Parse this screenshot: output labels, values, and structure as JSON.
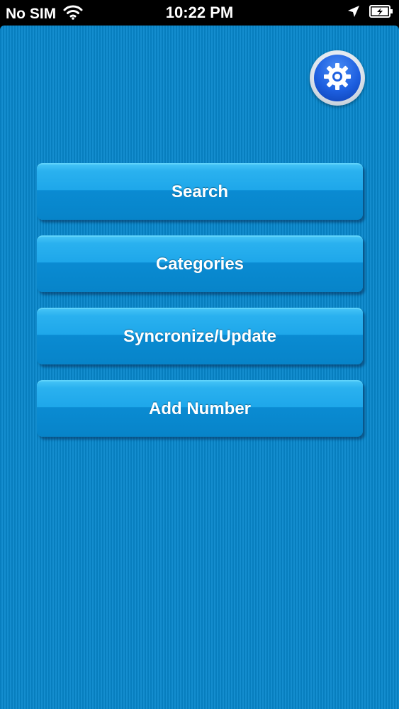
{
  "status_bar": {
    "carrier": "No SIM",
    "time": "10:22 PM"
  },
  "menu": {
    "buttons": [
      {
        "label": "Search"
      },
      {
        "label": "Categories"
      },
      {
        "label": "Syncronize/Update"
      },
      {
        "label": "Add Number"
      }
    ]
  },
  "icons": {
    "wifi": "wifi-icon",
    "location": "location-arrow-icon",
    "battery": "battery-charging-icon",
    "settings": "gear-icon"
  },
  "colors": {
    "background": "#0787cc",
    "button_top": "#43c3f6",
    "button_bottom": "#0784c9",
    "settings_blue": "#1d5fe0"
  }
}
